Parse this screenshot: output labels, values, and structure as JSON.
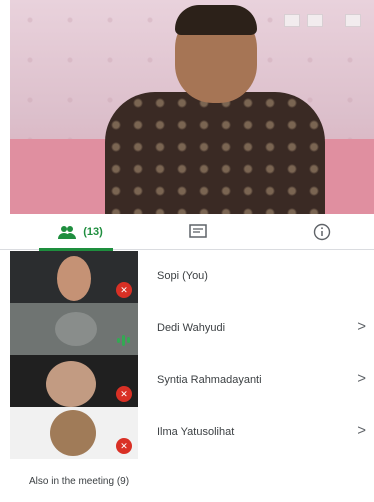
{
  "main_video": {
    "participant": "Host presenter"
  },
  "tabs": {
    "people": {
      "icon": "people-icon",
      "count_label": "(13)"
    },
    "chat": {
      "icon": "chat-icon"
    },
    "info": {
      "icon": "info-icon"
    }
  },
  "participants": [
    {
      "name": "Sopi (You)",
      "mic_state": "muted",
      "has_chevron": false
    },
    {
      "name": "Dedi Wahyudi",
      "mic_state": "speaking",
      "has_chevron": true
    },
    {
      "name": "Syntia Rahmadayanti",
      "mic_state": "muted",
      "has_chevron": true
    },
    {
      "name": "Ilma Yatusolihat",
      "mic_state": "muted",
      "has_chevron": true
    }
  ],
  "also_in_meeting": {
    "label": "Also in the meeting (9)"
  },
  "colors": {
    "accent": "#1e8e3e",
    "muted": "#d93025",
    "speaking": "#34a853"
  }
}
